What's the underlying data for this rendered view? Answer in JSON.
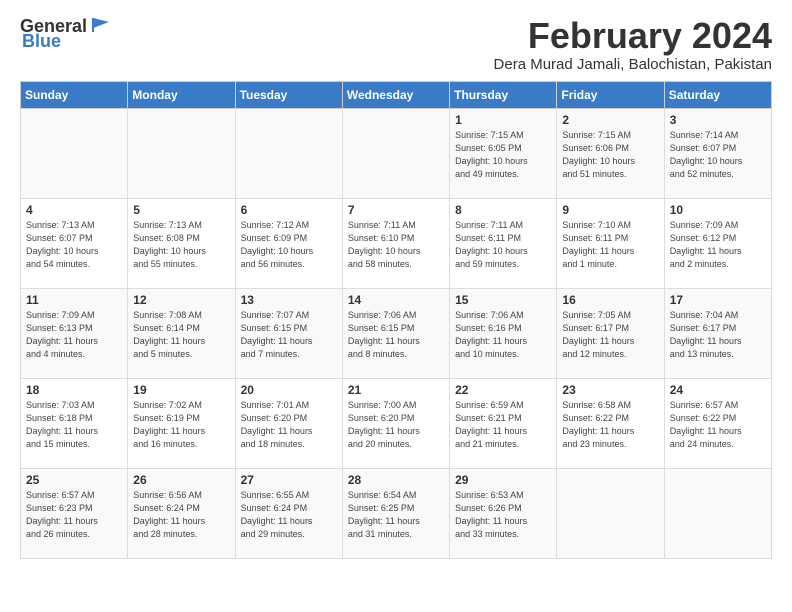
{
  "logo": {
    "general": "General",
    "blue": "Blue"
  },
  "header": {
    "month": "February 2024",
    "location": "Dera Murad Jamali, Balochistan, Pakistan"
  },
  "days_of_week": [
    "Sunday",
    "Monday",
    "Tuesday",
    "Wednesday",
    "Thursday",
    "Friday",
    "Saturday"
  ],
  "weeks": [
    [
      {
        "day": "",
        "info": ""
      },
      {
        "day": "",
        "info": ""
      },
      {
        "day": "",
        "info": ""
      },
      {
        "day": "",
        "info": ""
      },
      {
        "day": "1",
        "info": "Sunrise: 7:15 AM\nSunset: 6:05 PM\nDaylight: 10 hours\nand 49 minutes."
      },
      {
        "day": "2",
        "info": "Sunrise: 7:15 AM\nSunset: 6:06 PM\nDaylight: 10 hours\nand 51 minutes."
      },
      {
        "day": "3",
        "info": "Sunrise: 7:14 AM\nSunset: 6:07 PM\nDaylight: 10 hours\nand 52 minutes."
      }
    ],
    [
      {
        "day": "4",
        "info": "Sunrise: 7:13 AM\nSunset: 6:07 PM\nDaylight: 10 hours\nand 54 minutes."
      },
      {
        "day": "5",
        "info": "Sunrise: 7:13 AM\nSunset: 6:08 PM\nDaylight: 10 hours\nand 55 minutes."
      },
      {
        "day": "6",
        "info": "Sunrise: 7:12 AM\nSunset: 6:09 PM\nDaylight: 10 hours\nand 56 minutes."
      },
      {
        "day": "7",
        "info": "Sunrise: 7:11 AM\nSunset: 6:10 PM\nDaylight: 10 hours\nand 58 minutes."
      },
      {
        "day": "8",
        "info": "Sunrise: 7:11 AM\nSunset: 6:11 PM\nDaylight: 10 hours\nand 59 minutes."
      },
      {
        "day": "9",
        "info": "Sunrise: 7:10 AM\nSunset: 6:11 PM\nDaylight: 11 hours\nand 1 minute."
      },
      {
        "day": "10",
        "info": "Sunrise: 7:09 AM\nSunset: 6:12 PM\nDaylight: 11 hours\nand 2 minutes."
      }
    ],
    [
      {
        "day": "11",
        "info": "Sunrise: 7:09 AM\nSunset: 6:13 PM\nDaylight: 11 hours\nand 4 minutes."
      },
      {
        "day": "12",
        "info": "Sunrise: 7:08 AM\nSunset: 6:14 PM\nDaylight: 11 hours\nand 5 minutes."
      },
      {
        "day": "13",
        "info": "Sunrise: 7:07 AM\nSunset: 6:15 PM\nDaylight: 11 hours\nand 7 minutes."
      },
      {
        "day": "14",
        "info": "Sunrise: 7:06 AM\nSunset: 6:15 PM\nDaylight: 11 hours\nand 8 minutes."
      },
      {
        "day": "15",
        "info": "Sunrise: 7:06 AM\nSunset: 6:16 PM\nDaylight: 11 hours\nand 10 minutes."
      },
      {
        "day": "16",
        "info": "Sunrise: 7:05 AM\nSunset: 6:17 PM\nDaylight: 11 hours\nand 12 minutes."
      },
      {
        "day": "17",
        "info": "Sunrise: 7:04 AM\nSunset: 6:17 PM\nDaylight: 11 hours\nand 13 minutes."
      }
    ],
    [
      {
        "day": "18",
        "info": "Sunrise: 7:03 AM\nSunset: 6:18 PM\nDaylight: 11 hours\nand 15 minutes."
      },
      {
        "day": "19",
        "info": "Sunrise: 7:02 AM\nSunset: 6:19 PM\nDaylight: 11 hours\nand 16 minutes."
      },
      {
        "day": "20",
        "info": "Sunrise: 7:01 AM\nSunset: 6:20 PM\nDaylight: 11 hours\nand 18 minutes."
      },
      {
        "day": "21",
        "info": "Sunrise: 7:00 AM\nSunset: 6:20 PM\nDaylight: 11 hours\nand 20 minutes."
      },
      {
        "day": "22",
        "info": "Sunrise: 6:59 AM\nSunset: 6:21 PM\nDaylight: 11 hours\nand 21 minutes."
      },
      {
        "day": "23",
        "info": "Sunrise: 6:58 AM\nSunset: 6:22 PM\nDaylight: 11 hours\nand 23 minutes."
      },
      {
        "day": "24",
        "info": "Sunrise: 6:57 AM\nSunset: 6:22 PM\nDaylight: 11 hours\nand 24 minutes."
      }
    ],
    [
      {
        "day": "25",
        "info": "Sunrise: 6:57 AM\nSunset: 6:23 PM\nDaylight: 11 hours\nand 26 minutes."
      },
      {
        "day": "26",
        "info": "Sunrise: 6:56 AM\nSunset: 6:24 PM\nDaylight: 11 hours\nand 28 minutes."
      },
      {
        "day": "27",
        "info": "Sunrise: 6:55 AM\nSunset: 6:24 PM\nDaylight: 11 hours\nand 29 minutes."
      },
      {
        "day": "28",
        "info": "Sunrise: 6:54 AM\nSunset: 6:25 PM\nDaylight: 11 hours\nand 31 minutes."
      },
      {
        "day": "29",
        "info": "Sunrise: 6:53 AM\nSunset: 6:26 PM\nDaylight: 11 hours\nand 33 minutes."
      },
      {
        "day": "",
        "info": ""
      },
      {
        "day": "",
        "info": ""
      }
    ]
  ]
}
